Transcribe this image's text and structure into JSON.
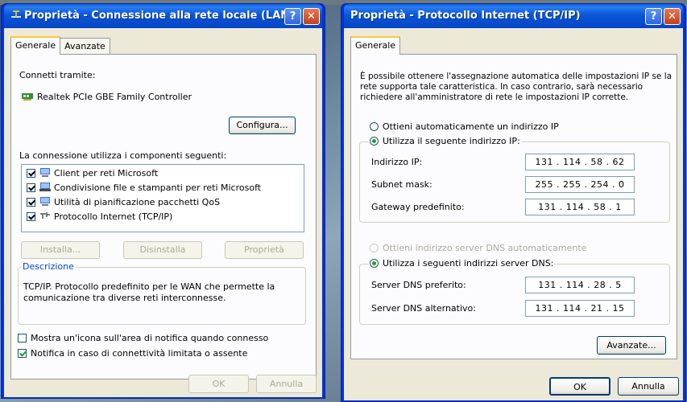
{
  "left_window": {
    "title": "Proprietà - Connessione alla rete locale (LAN)",
    "help_glyph": "?",
    "close_glyph": "✕",
    "tabs": [
      {
        "label": "Generale"
      },
      {
        "label": "Avanzate"
      }
    ],
    "connect_using_label": "Connetti tramite:",
    "adapter_name": "Realtek PCIe GBE Family Controller",
    "configure_button": "Configura...",
    "components_label": "La connessione utilizza i componenti seguenti:",
    "components": [
      {
        "label": "Client per reti Microsoft",
        "checked": true
      },
      {
        "label": "Condivisione file e stampanti per reti Microsoft",
        "checked": true
      },
      {
        "label": "Utilità di pianificazione pacchetti QoS",
        "checked": true
      },
      {
        "label": "Protocollo Internet (TCP/IP)",
        "checked": true
      }
    ],
    "install_button": "Installa...",
    "uninstall_button": "Disinstalla",
    "properties_button": "Proprietà",
    "description_legend": "Descrizione",
    "description_text_1": "TCP/IP. Protocollo predefinito per le WAN che permette la",
    "description_text_2": "comunicazione tra diverse reti interconnesse.",
    "show_icon_label": "Mostra un'icona sull'area di notifica quando connesso",
    "show_icon_checked": false,
    "notify_label": "Notifica in caso di connettività limitata o assente",
    "notify_checked": true,
    "ok_button": "OK",
    "cancel_button": "Annulla"
  },
  "right_window": {
    "title": "Proprietà - Protocollo Internet (TCP/IP)",
    "help_glyph": "?",
    "close_glyph": "✕",
    "tabs": [
      {
        "label": "Generale"
      }
    ],
    "intro_1": "È possibile ottenere l'assegnazione automatica delle impostazioni IP se la",
    "intro_2": "rete supporta tale caratteristica. In caso contrario, sarà necessario",
    "intro_3": "richiedere all'amministratore di rete le impostazioni IP corrette.",
    "auto_ip_label": "Ottieni automaticamente un indirizzo IP",
    "auto_ip_selected": false,
    "manual_ip_label": "Utilizza il seguente indirizzo IP:",
    "manual_ip_selected": true,
    "ip_label": "Indirizzo IP:",
    "ip_value": "131 . 114 . 58 . 62",
    "subnet_label": "Subnet mask:",
    "subnet_value": "255 . 255 . 254 . 0",
    "gateway_label": "Gateway predefinito:",
    "gateway_value": "131 . 114 . 58 . 1",
    "auto_dns_label": "Ottieni indirizzo server DNS automaticamente",
    "auto_dns_selected": false,
    "manual_dns_label": "Utilizza i seguenti indirizzi server DNS:",
    "manual_dns_selected": true,
    "preferred_dns_label": "Server DNS preferito:",
    "preferred_dns_value": "131 . 114 . 28 . 5",
    "alternate_dns_label": "Server DNS alternativo:",
    "alternate_dns_value": "131 . 114 . 21 . 15",
    "advanced_button": "Avanzate...",
    "ok_button": "OK",
    "cancel_button": "Annulla"
  }
}
